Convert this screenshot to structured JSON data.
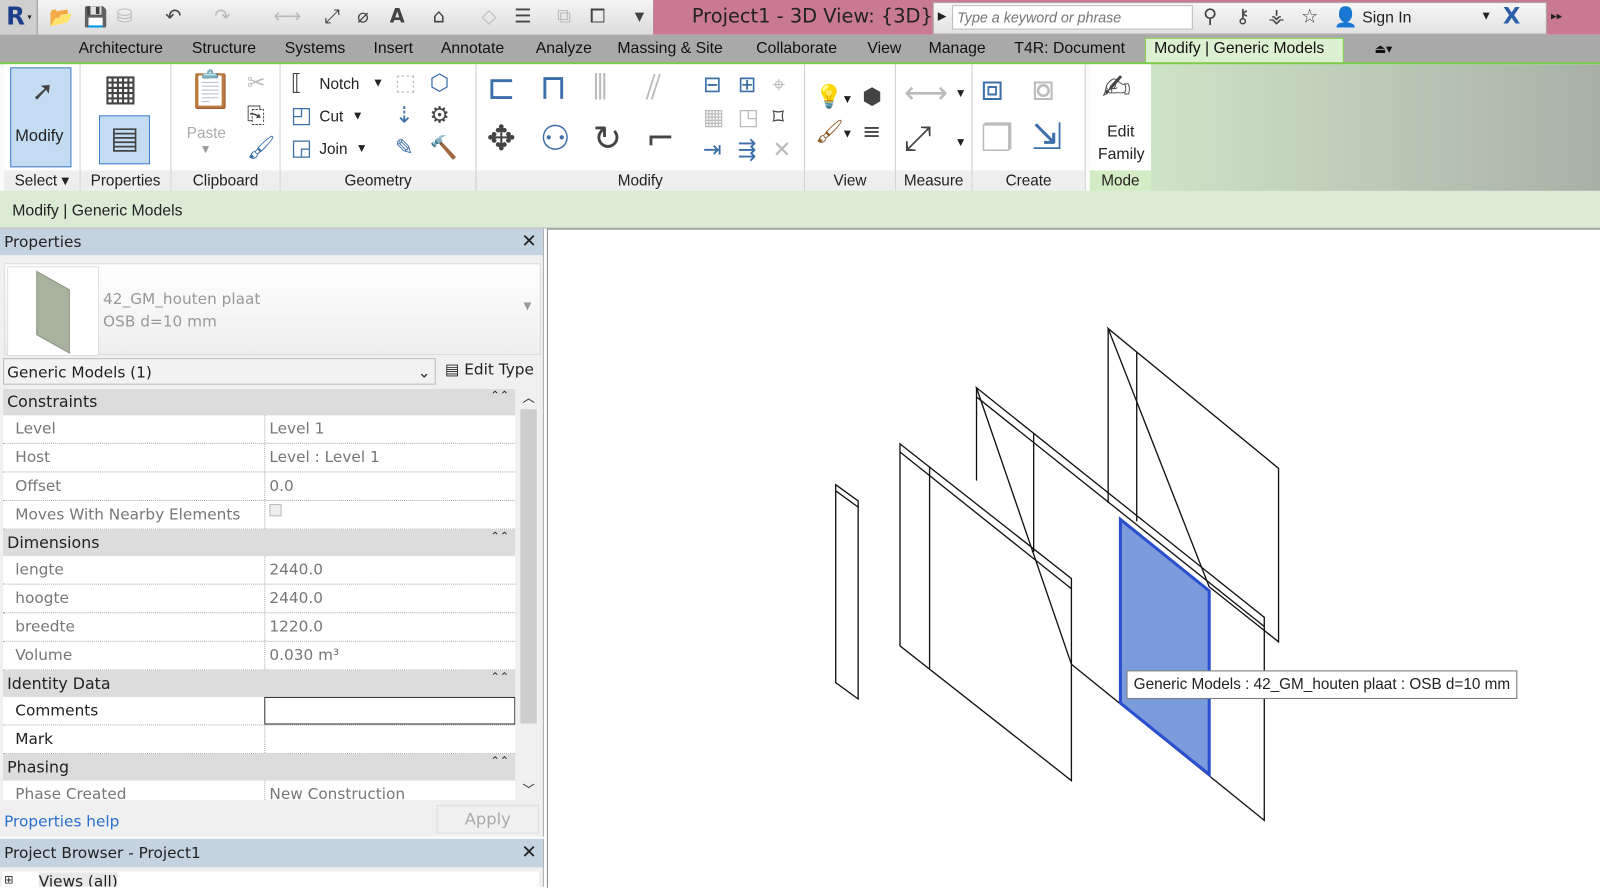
{
  "title_bar": {
    "title": "Project1 - 3D View: {3D}",
    "search_placeholder": "Type a keyword or phrase",
    "sign_in": "Sign In"
  },
  "quick_access": {
    "icons": [
      "revit-app-icon",
      "open-icon",
      "save-icon",
      "sync-icon",
      "undo-icon",
      "redo-icon",
      "measure-icon",
      "aligned-dimension-icon",
      "tag-icon",
      "text-icon",
      "3d-view-icon",
      "section-icon",
      "thin-lines-icon",
      "close-hidden-icon",
      "switch-windows-icon",
      "customize-icon"
    ]
  },
  "tabs": [
    "Architecture",
    "Structure",
    "Systems",
    "Insert",
    "Annotate",
    "Analyze",
    "Massing & Site",
    "Collaborate",
    "View",
    "Manage",
    "T4R: Document",
    "Modify | Generic Models"
  ],
  "active_tab": "Modify | Generic Models",
  "ribbon": {
    "select": {
      "modify": "Modify",
      "label": "Select"
    },
    "properties": {
      "label": "Properties"
    },
    "clipboard": {
      "paste": "Paste",
      "label": "Clipboard"
    },
    "geometry": {
      "notch": "Notch",
      "cut": "Cut",
      "join": "Join",
      "label": "Geometry"
    },
    "modify": {
      "label": "Modify"
    },
    "view": {
      "label": "View"
    },
    "measure": {
      "label": "Measure"
    },
    "create": {
      "label": "Create"
    },
    "mode": {
      "edit_family_1": "Edit",
      "edit_family_2": "Family",
      "label": "Mode"
    }
  },
  "context_bar": "Modify | Generic Models",
  "properties": {
    "title": "Properties",
    "type_name": "42_GM_houten plaat",
    "type_sub": "OSB d=10 mm",
    "category": "Generic Models (1)",
    "edit_type": "Edit Type",
    "groups": [
      {
        "name": "Constraints",
        "rows": [
          {
            "k": "Level",
            "v": "Level 1"
          },
          {
            "k": "Host",
            "v": "Level : Level 1"
          },
          {
            "k": "Offset",
            "v": "0.0"
          },
          {
            "k": "Moves With Nearby Elements",
            "v": ""
          }
        ]
      },
      {
        "name": "Dimensions",
        "rows": [
          {
            "k": "lengte",
            "v": "2440.0"
          },
          {
            "k": "hoogte",
            "v": "2440.0"
          },
          {
            "k": "breedte",
            "v": "1220.0"
          },
          {
            "k": "Volume",
            "v": "0.030 m³"
          }
        ]
      },
      {
        "name": "Identity Data",
        "rows": [
          {
            "k": "Comments",
            "v": ""
          },
          {
            "k": "Mark",
            "v": ""
          }
        ]
      },
      {
        "name": "Phasing",
        "rows": [
          {
            "k": "Phase Created",
            "v": "New Construction"
          }
        ]
      }
    ],
    "help": "Properties help",
    "apply": "Apply"
  },
  "project_browser": {
    "title": "Project Browser - Project1",
    "root": "Views (all)"
  },
  "viewport": {
    "tooltip": "Generic Models : 42_GM_houten plaat : OSB d=10 mm",
    "selection_color": "#7b9bdc"
  }
}
